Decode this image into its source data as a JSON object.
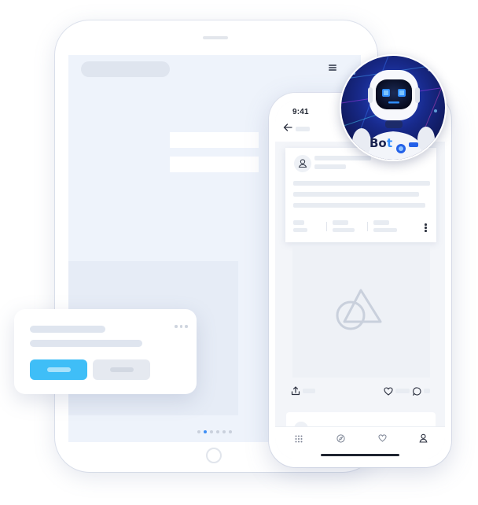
{
  "phone": {
    "status_time": "9:41",
    "nav_icons": [
      "grid-icon",
      "compass-icon",
      "heart-icon",
      "user-icon"
    ],
    "post_icons": [
      "share-icon",
      "heart-icon",
      "comment-icon"
    ]
  },
  "robot": {
    "chest_text_b": "Bo",
    "chest_text_t": "t"
  },
  "colors": {
    "accent": "#3fbef7",
    "active_dot": "#3d8ef5",
    "placeholder": "#dfe5ef"
  },
  "tablet": {
    "page_dots": 6,
    "active_dot_index": 1
  }
}
